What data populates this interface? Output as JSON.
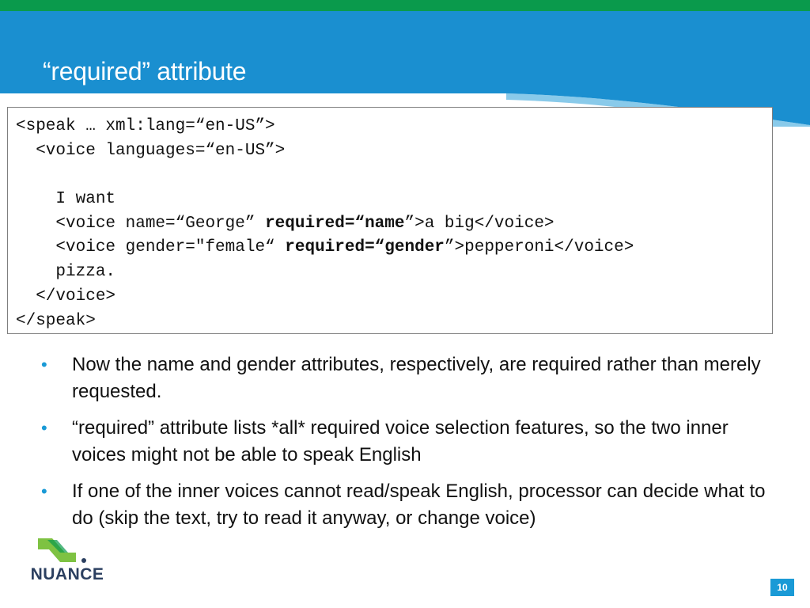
{
  "slide": {
    "title": "“required” attribute",
    "page_number": "10"
  },
  "code": {
    "lines": [
      {
        "text": "<speak … xml:lang=“en-US”>"
      },
      {
        "text": "  <voice languages=“en-US”>"
      },
      {
        "text": ""
      },
      {
        "text": "    I want"
      },
      {
        "pre": "    <voice name=“George” ",
        "bold": "required=“name",
        "post": "”>a big</voice>"
      },
      {
        "pre": "    <voice gender=\"female“ ",
        "bold": "required=“gender",
        "post": "”>pepperoni</voice>"
      },
      {
        "text": "    pizza."
      },
      {
        "text": "  </voice>"
      },
      {
        "text": "</speak>"
      }
    ]
  },
  "bullets": [
    {
      "text": "Now the name and gender attributes, respectively, are required rather than merely requested."
    },
    {
      "text": "“required” attribute lists *all* required voice selection features, so the two inner voices might not be able to speak English"
    },
    {
      "text": "If one of the inner voices cannot read/speak English, processor can decide what to do (skip the text, try to read it anyway, or change voice)"
    }
  ],
  "bullet_symbol": "•",
  "logo": {
    "text": "NUANCE"
  },
  "colors": {
    "header_blue": "#1a8fd0",
    "header_green": "#0a9a4c",
    "accent": "#1a9ad6",
    "logo_text": "#2b3f60"
  }
}
